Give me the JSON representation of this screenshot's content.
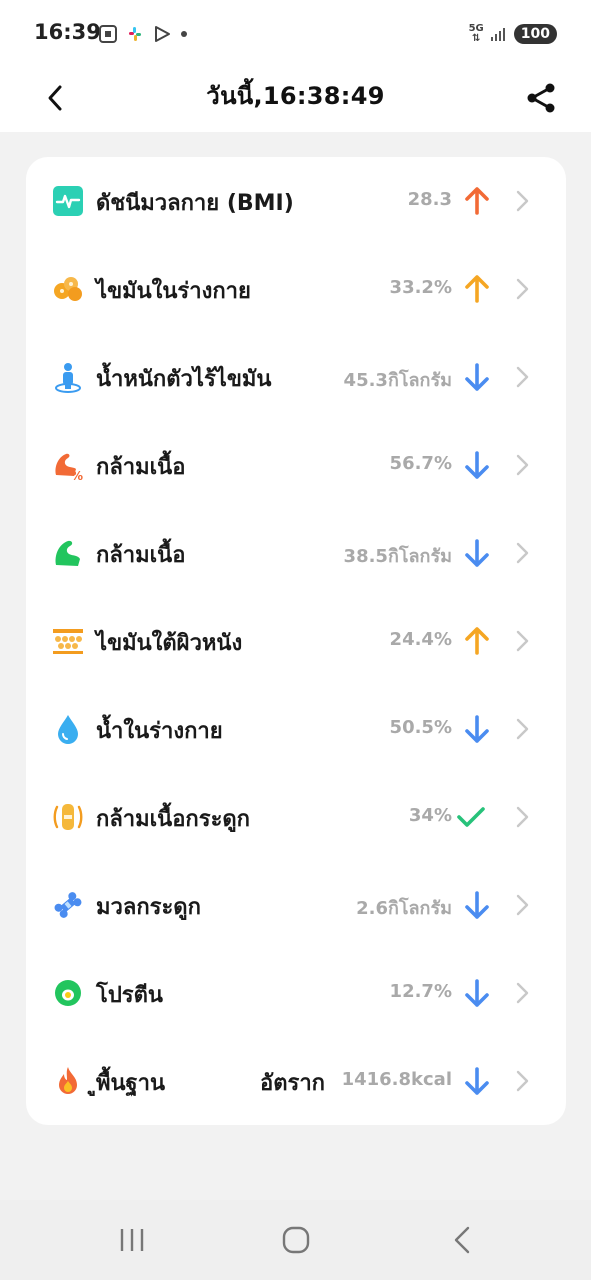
{
  "status_bar": {
    "time": "16:39",
    "network": "5G",
    "battery": "100"
  },
  "header": {
    "title": "วันนี้,16:38:49"
  },
  "metrics": [
    {
      "label": "ดัชนีมวลกาย (BMI)",
      "value": "28.3",
      "trend": "up",
      "icon": "heartbeat-icon"
    },
    {
      "label": "ไขมันในร่างกาย",
      "value": "33.2%",
      "trend": "up",
      "icon": "body-fat-icon"
    },
    {
      "label": "น้ำหนักตัวไร้ไขมัน",
      "value": "45.3กิโลกรัม",
      "trend": "down",
      "icon": "person-icon"
    },
    {
      "label": "กล้ามเนื้อ",
      "value": "56.7%",
      "trend": "down",
      "icon": "muscle-percent-icon"
    },
    {
      "label": "กล้ามเนื้อ",
      "value": "38.5กิโลกรัม",
      "trend": "down",
      "icon": "muscle-icon"
    },
    {
      "label": "ไขมันใต้ผิวหนัง",
      "value": "24.4%",
      "trend": "up",
      "icon": "subcutaneous-fat-icon"
    },
    {
      "label": "น้ำในร่างกาย",
      "value": "50.5%",
      "trend": "down",
      "icon": "water-drop-icon"
    },
    {
      "label": "กล้ามเนื้อกระดูก",
      "value": "34%",
      "trend": "ok",
      "icon": "skeletal-muscle-icon"
    },
    {
      "label": "มวลกระดูก",
      "value": "2.6กิโลกรัม",
      "trend": "down",
      "icon": "bone-icon"
    },
    {
      "label": "โปรตีน",
      "value": "12.7%",
      "trend": "down",
      "icon": "protein-icon"
    },
    {
      "label": "ูพื้นฐาน",
      "label_extra": "อัตราก",
      "value": "1416.8kcal",
      "trend": "down",
      "icon": "flame-icon"
    }
  ],
  "colors": {
    "arrow_up_red": "#f26a36",
    "arrow_up_orange": "#f5a623",
    "arrow_down": "#4a8cf0",
    "check": "#27c27a",
    "value_gray": "#a9a9a9"
  }
}
